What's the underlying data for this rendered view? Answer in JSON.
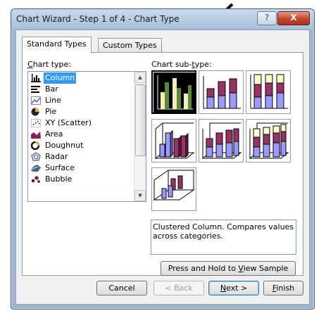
{
  "window": {
    "title": "Chart Wizard - Step 1 of 4 - Chart Type",
    "help_glyph": "?",
    "close_glyph": "X"
  },
  "tabs": [
    {
      "label": "Standard Types",
      "active": true
    },
    {
      "label": "Custom Types",
      "active": false
    }
  ],
  "chart_type_label": {
    "pre": "",
    "accel": "C",
    "post": "hart type:"
  },
  "chart_subtype_label": {
    "pre": "Chart sub-",
    "accel": "t",
    "post": "ype:"
  },
  "chart_types": [
    {
      "label": "Column",
      "icon": "column-chart-icon",
      "selected": true
    },
    {
      "label": "Bar",
      "icon": "bar-chart-icon"
    },
    {
      "label": "Line",
      "icon": "line-chart-icon"
    },
    {
      "label": "Pie",
      "icon": "pie-chart-icon"
    },
    {
      "label": "XY (Scatter)",
      "icon": "scatter-chart-icon"
    },
    {
      "label": "Area",
      "icon": "area-chart-icon"
    },
    {
      "label": "Doughnut",
      "icon": "doughnut-chart-icon"
    },
    {
      "label": "Radar",
      "icon": "radar-chart-icon"
    },
    {
      "label": "Surface",
      "icon": "surface-chart-icon"
    },
    {
      "label": "Bubble",
      "icon": "bubble-chart-icon"
    }
  ],
  "subtypes": [
    {
      "name": "clustered-column",
      "selected": true
    },
    {
      "name": "stacked-column"
    },
    {
      "name": "100-percent-stacked-column"
    },
    {
      "name": "3d-clustered-column"
    },
    {
      "name": "3d-stacked-column"
    },
    {
      "name": "3d-100-percent-stacked-column"
    },
    {
      "name": "3d-column"
    }
  ],
  "description": "Clustered Column. Compares values across categories.",
  "buttons": {
    "view_sample": {
      "pre": "Press and Hold to ",
      "accel": "V",
      "post": "iew Sample"
    },
    "cancel": "Cancel",
    "back": "< Back",
    "next": {
      "pre": "",
      "accel": "N",
      "post": "ext >"
    },
    "finish": {
      "pre": "",
      "accel": "F",
      "post": "inish"
    }
  },
  "colors": {
    "selection": "#3399ff",
    "series_green": "#5a8a3a",
    "series_blue": "#9999ff",
    "series_maroon": "#993366",
    "series_yellow": "#ffffcc"
  }
}
